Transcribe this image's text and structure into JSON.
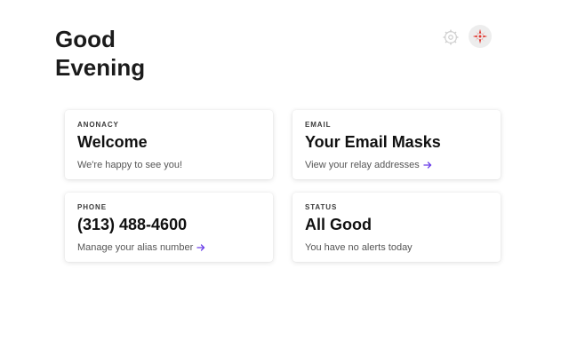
{
  "greeting": {
    "line1": "Good",
    "line2": "Evening"
  },
  "header": {
    "settings_icon": "gear-icon",
    "avatar_icon": "avatar-icon"
  },
  "cards": [
    {
      "label": "ANONACY",
      "title": "Welcome",
      "subtitle": "We're happy to see you!"
    },
    {
      "label": "EMAIL",
      "title": "Your Email Masks",
      "subtitle": "View your relay addresses"
    },
    {
      "label": "PHONE",
      "title": "(313) 488-4600",
      "subtitle": "Manage your alias number"
    },
    {
      "label": "STATUS",
      "title": "All Good",
      "subtitle": "You have no alerts today"
    }
  ],
  "colors": {
    "accent": "#6a3de8",
    "avatar_mark": "#e0342c",
    "card_background": "#ffffff",
    "text_primary": "#111111",
    "text_secondary": "#555555"
  }
}
